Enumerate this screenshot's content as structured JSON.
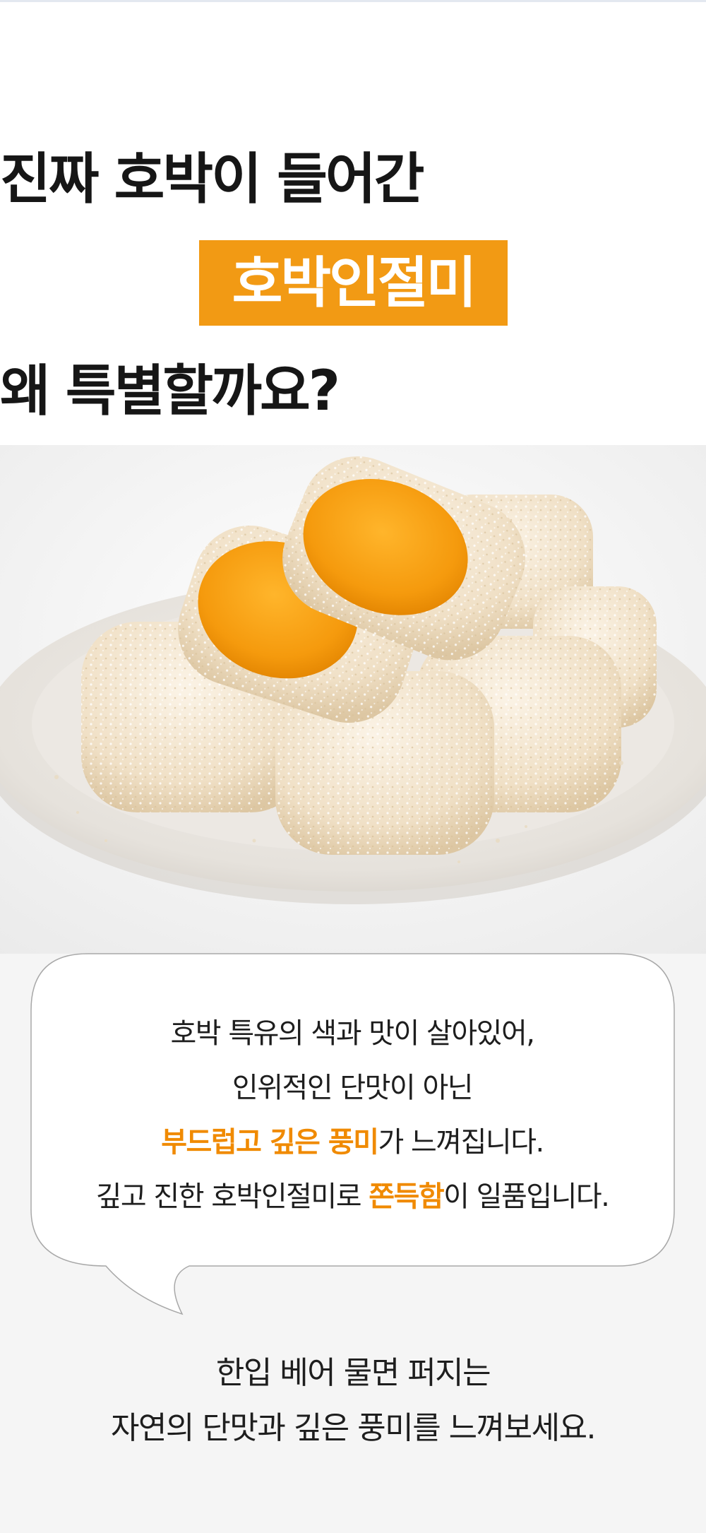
{
  "headline": {
    "line1": "진짜 호박이 들어간",
    "line2_highlight": "호박인절미",
    "line3": "왜 특별할까요?"
  },
  "colors": {
    "accent": "#f29a14",
    "highlight_text": "#f08a00",
    "text": "#1e1e1e",
    "background_lower": "#f5f5f5"
  },
  "image": {
    "subject": "pumpkin injeolmi rice cakes on a white plate"
  },
  "speech_bubble": {
    "line1": "호박 특유의 색과 맛이 살아있어,",
    "line2": "인위적인 단맛이 아닌",
    "line3_highlight": "부드럽고 깊은 풍미",
    "line3_rest": "가 느껴집니다.",
    "line4_start": "깊고 진한 호박인절미로 ",
    "line4_highlight": "쫀득함",
    "line4_end": "이 일품입니다."
  },
  "closing": {
    "line1": "한입 베어 물면 퍼지는",
    "line2": "자연의 단맛과 깊은 풍미를 느껴보세요."
  }
}
